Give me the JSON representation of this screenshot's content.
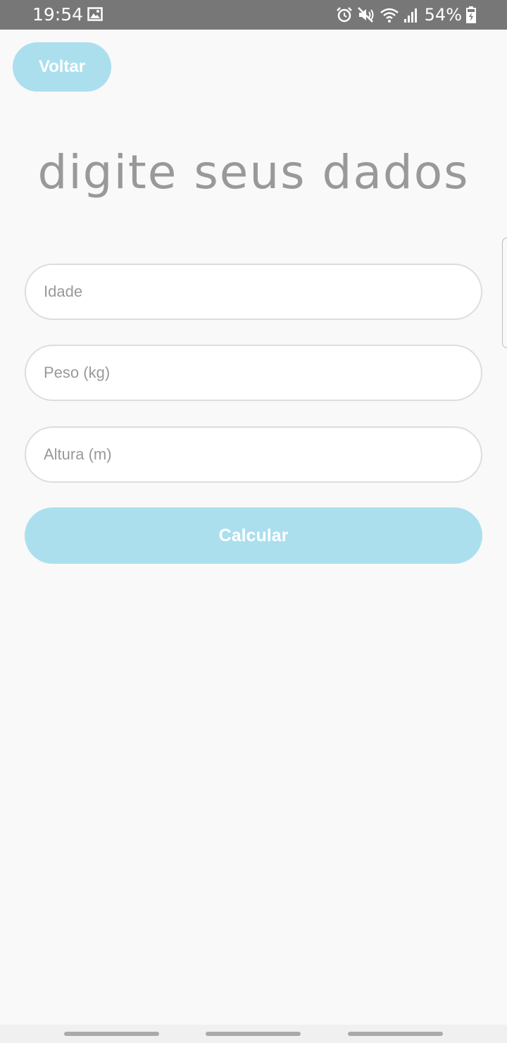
{
  "status_bar": {
    "time": "19:54",
    "battery": "54%",
    "icons": [
      "gallery-icon",
      "alarm-icon",
      "mute-icon",
      "wifi-icon",
      "signal-icon",
      "battery-icon"
    ]
  },
  "header": {
    "back_label": "Voltar"
  },
  "main": {
    "title": "digite seus dados",
    "fields": [
      {
        "placeholder": "Idade",
        "value": ""
      },
      {
        "placeholder": "Peso (kg)",
        "value": ""
      },
      {
        "placeholder": "Altura (m)",
        "value": ""
      }
    ],
    "submit_label": "Calcular"
  },
  "colors": {
    "accent": "#abdfee",
    "status_bar": "#777777",
    "background": "#f9f9f9",
    "title_text": "#999999"
  }
}
